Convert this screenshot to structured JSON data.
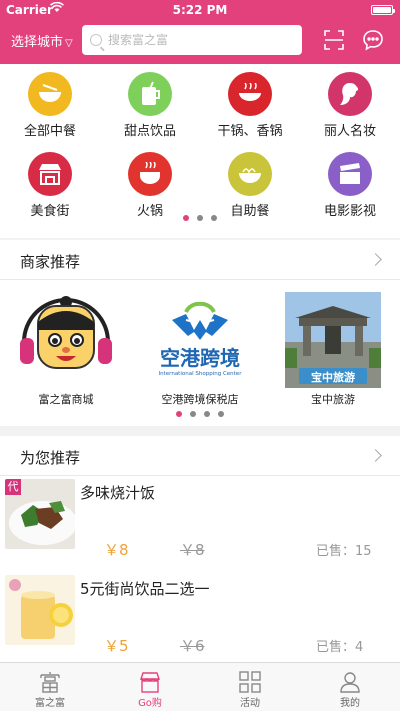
{
  "status": {
    "carrier": "Carrier",
    "time": "5:22 PM"
  },
  "header": {
    "city": "选择城市",
    "search_placeholder": "搜索富之富",
    "brand_color": "#e3417c"
  },
  "categories": [
    {
      "label": "全部中餐",
      "icon": "bowl-icon",
      "color": "#f2b81f"
    },
    {
      "label": "甜点饮品",
      "icon": "drink-icon",
      "color": "#7ed05b"
    },
    {
      "label": "干锅、香锅",
      "icon": "wok-icon",
      "color": "#d9262d"
    },
    {
      "label": "丽人名妆",
      "icon": "beauty-icon",
      "color": "#d2356a"
    },
    {
      "label": "美食街",
      "icon": "storefront-icon",
      "color": "#d82b45"
    },
    {
      "label": "火锅",
      "icon": "hotpot-icon",
      "color": "#e2342f"
    },
    {
      "label": "自助餐",
      "icon": "noodles-icon",
      "color": "#c9c43a"
    },
    {
      "label": "电影影视",
      "icon": "clapper-icon",
      "color": "#8a5fc8"
    }
  ],
  "merchants_section": {
    "title": "商家推荐"
  },
  "merchants": [
    {
      "name": "富之富商城",
      "logo": "mascot-logo"
    },
    {
      "name": "空港跨境保税店",
      "logo": "airport-cross-border-logo",
      "logo_text": "空港跨境",
      "logo_subtext": "International Shopping Center"
    },
    {
      "name": "宝中旅游",
      "logo": "gate-photo-logo",
      "logo_text": "宝中旅游"
    }
  ],
  "recommend_section": {
    "title": "为您推荐"
  },
  "products": [
    {
      "title": "多味烧汁饭",
      "price": "￥8",
      "old_price": "￥8",
      "sold": "已售：15",
      "badge": "代"
    },
    {
      "title": "5元街尚饮品二选一",
      "price": "￥5",
      "old_price": "￥6",
      "sold": "已售：4"
    }
  ],
  "tabs": [
    {
      "label": "富之富",
      "icon": "fu-icon"
    },
    {
      "label": "Go购",
      "icon": "shop-icon",
      "active": true
    },
    {
      "label": "活动",
      "icon": "grid-icon"
    },
    {
      "label": "我的",
      "icon": "user-icon"
    }
  ]
}
